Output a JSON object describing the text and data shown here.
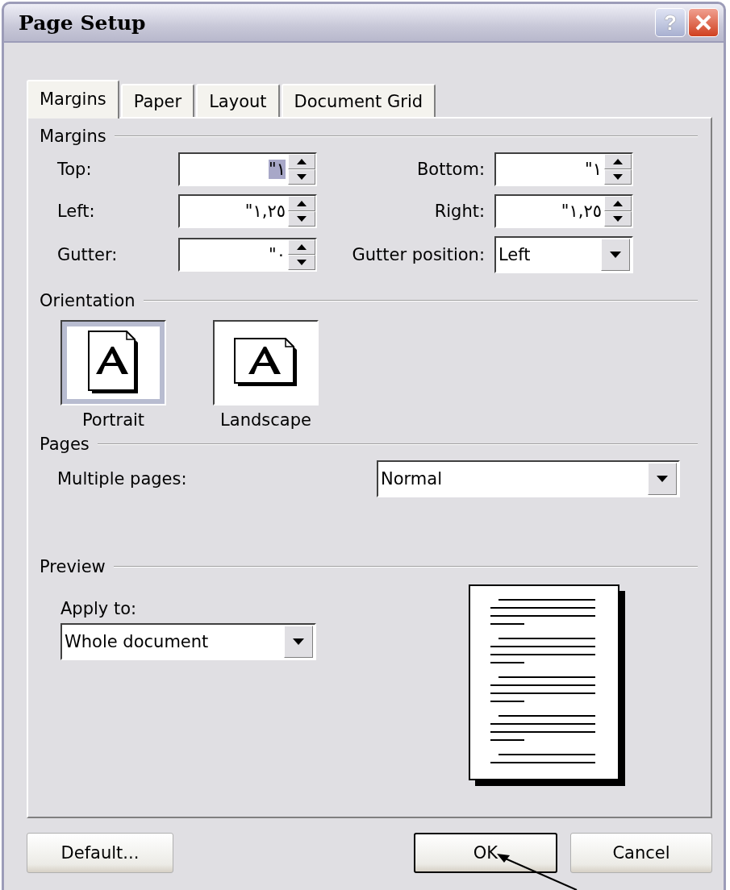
{
  "window": {
    "title": "Page Setup",
    "help_button": "?"
  },
  "tabs": [
    {
      "label": "Margins",
      "selected": true
    },
    {
      "label": "Paper",
      "selected": false
    },
    {
      "label": "Layout",
      "selected": false
    },
    {
      "label": "Document Grid",
      "selected": false
    }
  ],
  "margins": {
    "title": "Margins",
    "fields": [
      {
        "label": "Top:",
        "value": "\"١",
        "text_selected": true
      },
      {
        "label": "Bottom:",
        "value": "\"١",
        "text_selected": false
      },
      {
        "label": "Left:",
        "value": "\"١,٢٥",
        "text_selected": false
      },
      {
        "label": "Right:",
        "value": "\"١,٢٥",
        "text_selected": false
      },
      {
        "label": "Gutter:",
        "value": "\"٠",
        "text_selected": false
      }
    ],
    "gutter_position": {
      "label": "Gutter position:",
      "value": "Left"
    }
  },
  "orientation": {
    "title": "Orientation",
    "options": [
      {
        "label": "Portrait",
        "selected": true
      },
      {
        "label": "Landscape",
        "selected": false
      }
    ]
  },
  "pages": {
    "title": "Pages",
    "label": "Multiple pages:",
    "value": "Normal"
  },
  "preview": {
    "title": "Preview",
    "apply_label": "Apply to:",
    "apply_value": "Whole document"
  },
  "buttons": [
    {
      "label": "Default...",
      "kind": "left"
    },
    {
      "label": "OK",
      "kind": "default"
    },
    {
      "label": "Cancel",
      "kind": "right"
    }
  ]
}
